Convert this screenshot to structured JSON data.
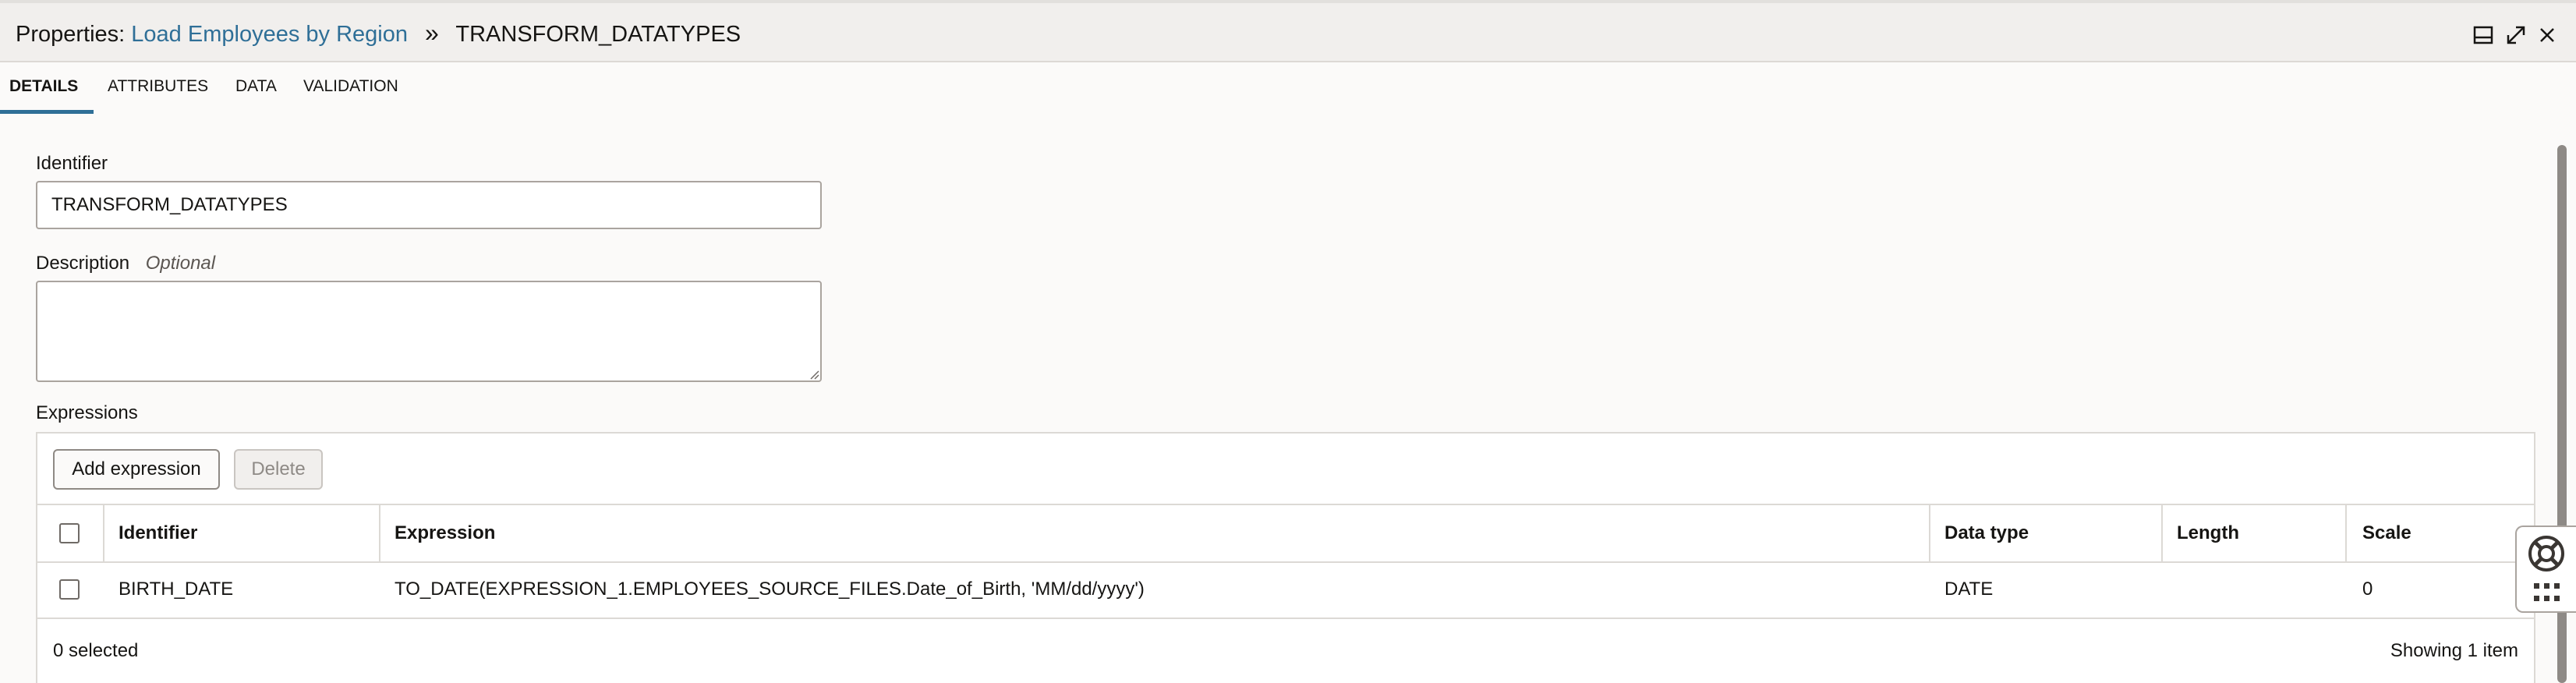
{
  "header": {
    "prefix": "Properties:",
    "link_text": "Load Employees by Region",
    "separator": "»",
    "current": "TRANSFORM_DATATYPES",
    "icons": [
      "dock-icon",
      "expand-icon",
      "close-icon"
    ]
  },
  "tabs": [
    {
      "label": "DETAILS",
      "active": true
    },
    {
      "label": "ATTRIBUTES",
      "active": false
    },
    {
      "label": "DATA",
      "active": false
    },
    {
      "label": "VALIDATION",
      "active": false
    }
  ],
  "form": {
    "identifier_label": "Identifier",
    "identifier_value": "TRANSFORM_DATATYPES",
    "description_label": "Description",
    "description_optional": "Optional",
    "description_value": "",
    "expressions_label": "Expressions"
  },
  "toolbar": {
    "add_label": "Add expression",
    "delete_label": "Delete"
  },
  "table": {
    "columns": [
      "Identifier",
      "Expression",
      "Data type",
      "Length",
      "Scale"
    ],
    "rows": [
      {
        "identifier": "BIRTH_DATE",
        "expression": "TO_DATE(EXPRESSION_1.EMPLOYEES_SOURCE_FILES.Date_of_Birth, 'MM/dd/yyyy')",
        "data_type": "DATE",
        "length": "",
        "scale": "0"
      }
    ],
    "selected_text": "0 selected",
    "count_text": "Showing 1 item"
  },
  "colors": {
    "accent": "#2f6f97",
    "header_bg": "#f1efed",
    "page_bg": "#fbfaf9"
  }
}
